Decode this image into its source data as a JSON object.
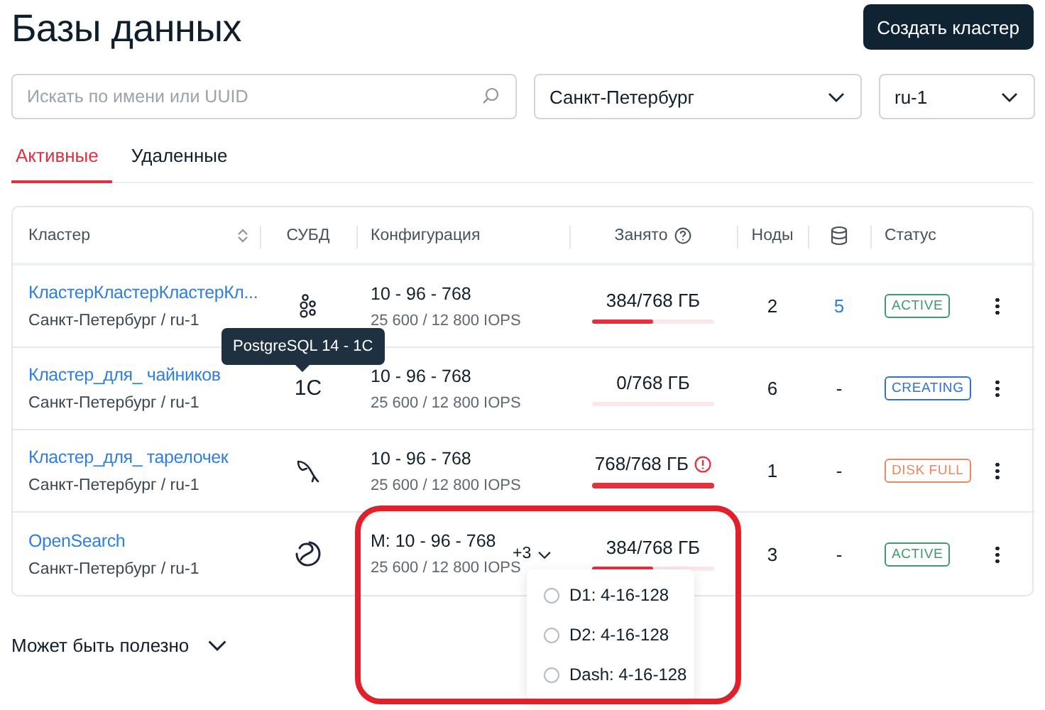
{
  "page": {
    "title": "Базы данных",
    "create_button": "Создать кластер"
  },
  "filters": {
    "search": {
      "placeholder": "Искать по имени или UUID"
    },
    "city": "Санкт-Петербург",
    "region": "ru-1"
  },
  "tabs": [
    {
      "label": "Активные",
      "selected": true
    },
    {
      "label": "Удаленные",
      "selected": false
    }
  ],
  "table": {
    "columns": [
      {
        "kind": "sort",
        "label": "Кластер"
      },
      {
        "kind": "text",
        "label": "СУБД"
      },
      {
        "kind": "text",
        "label": "Конфигурация"
      },
      {
        "kind": "help",
        "label": "Занято"
      },
      {
        "kind": "text",
        "label": "Ноды"
      },
      {
        "kind": "database"
      },
      {
        "kind": "text",
        "label": "Статус"
      }
    ],
    "rows": [
      {
        "name": "КластерКластерКластерКл...",
        "location": "Санкт-Петербург / ru-1",
        "dbms": {
          "kind": "dots"
        },
        "config": "10 - 96 - 768",
        "iops": "25 600 / 12 800 IOPS",
        "used": "384/768 ГБ",
        "level": 0.5,
        "warning": false,
        "nodes": "2",
        "databases": {
          "text": "5",
          "link": true
        },
        "status": {
          "label": "ACTIVE",
          "color": "#3e9a6e"
        }
      },
      {
        "name": "Кластер_для_ чайников",
        "location": "Санкт-Петербург / ru-1",
        "dbms": {
          "kind": "onec",
          "label": "1C"
        },
        "tooltip": "PostgreSQL 14 - 1C",
        "config": "10 - 96 - 768",
        "iops": "25 600 / 12 800 IOPS",
        "used": "0/768 ГБ",
        "level": 0,
        "warning": false,
        "nodes": "6",
        "databases": {
          "text": "-",
          "link": false
        },
        "status": {
          "label": "CREATING",
          "color": "#2f72d0"
        }
      },
      {
        "name": "Кластер_для_ тарелочек",
        "location": "Санкт-Петербург / ru-1",
        "dbms": {
          "kind": "dolphin"
        },
        "config": "10 - 96 - 768",
        "iops": "25 600 / 12 800 IOPS",
        "used": "768/768 ГБ",
        "level": 1,
        "warning": true,
        "nodes": "1",
        "databases": {
          "text": "-",
          "link": false
        },
        "status": {
          "label": "DISK FULL",
          "color": "#f0875e"
        }
      },
      {
        "name": "OpenSearch",
        "location": "Санкт-Петербург / ru-1",
        "dbms": {
          "kind": "opensearch"
        },
        "config": "M: 10 - 96 - 768",
        "iops": "25 600 / 12 800 IOPS",
        "extra": {
          "label": "+3",
          "expanded": true,
          "options": [
            {
              "label": "D1: 4-16-128",
              "selected": false
            },
            {
              "label": "D2: 4-16-128",
              "selected": false
            },
            {
              "label": "Dash: 4-16-128",
              "selected": false
            }
          ]
        },
        "used": "384/768 ГБ",
        "level": 0.5,
        "warning": false,
        "nodes": "3",
        "databases": {
          "text": "-",
          "link": false
        },
        "status": {
          "label": "ACTIVE",
          "color": "#3e9a6e"
        }
      }
    ]
  },
  "footer": {
    "label": "Может быть полезно",
    "expanded": false
  }
}
